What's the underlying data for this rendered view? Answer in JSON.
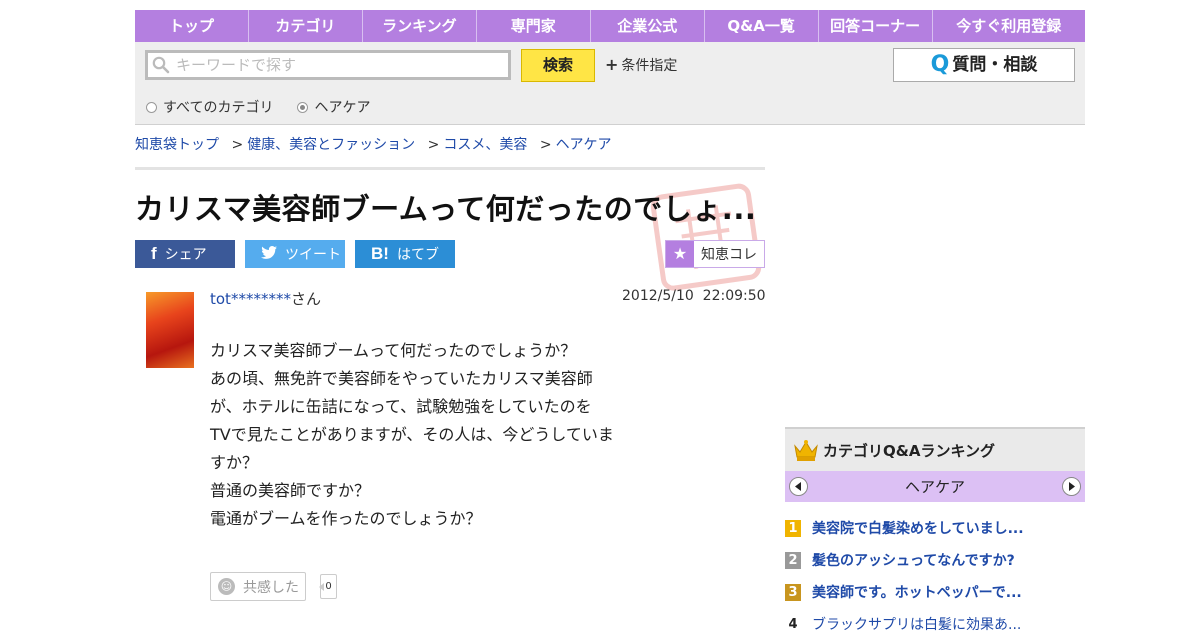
{
  "nav": {
    "items": [
      "トップ",
      "カテゴリ",
      "ランキング",
      "専門家",
      "企業公式",
      "Q&A一覧",
      "回答コーナー",
      "今すぐ利用登録"
    ]
  },
  "search": {
    "placeholder": "キーワードで探す",
    "button_label": "検索",
    "conditions_label": "条件指定",
    "scope_all": "すべてのカテゴリ",
    "scope_current": "ヘアケア",
    "ask_button": "質問・相談",
    "ask_icon_letter": "Q"
  },
  "breadcrumb": [
    "知恵袋トップ",
    "健康、美容とファッション",
    "コスメ、美容",
    "ヘアケア"
  ],
  "question": {
    "title": "カリスマ美容師ブームって何だったのでしょ...",
    "user": "tot********",
    "user_suffix": "さん",
    "date": "2012/5/10  22:09:50",
    "body": [
      "カリスマ美容師ブームって何だったのでしょうか？",
      "あの頃、無免許で美容師をやっていたカリスマ美容師",
      "が、ホテルに缶詰になって、試験勉強をしていたのを",
      "TVで見たことがありますが、その人は、今どうしていま",
      "すか？",
      "普通の美容師ですか？",
      "電通がブームを作ったのでしょうか？"
    ],
    "empathy_label": "共感した",
    "empathy_count": "0"
  },
  "share": {
    "facebook": "シェア",
    "twitter": "ツイート",
    "hatena": "はてブ",
    "hatena_icon": "B!",
    "chie_kore": "知恵コレ"
  },
  "ranking": {
    "title": "カテゴリQ&Aランキング",
    "category": "ヘアケア",
    "items": [
      {
        "rank": "1",
        "title": "美容院で白髪染めをしていまし..."
      },
      {
        "rank": "2",
        "title": "髪色のアッシュってなんですか?"
      },
      {
        "rank": "3",
        "title": "美容師です。ホットペッパーで..."
      },
      {
        "rank": "4",
        "title": "ブラックサプリは白髪に効果あ..."
      }
    ]
  },
  "colors": {
    "nav_bg": "#b47fe0",
    "search_button": "#ffe545",
    "link": "#1f4aa8",
    "facebook": "#3b5998",
    "twitter": "#55acee",
    "hatena": "#2c8ed6",
    "rank_gold": "#f0b400",
    "rank_silver": "#999999",
    "rank_bronze": "#c8951f"
  }
}
